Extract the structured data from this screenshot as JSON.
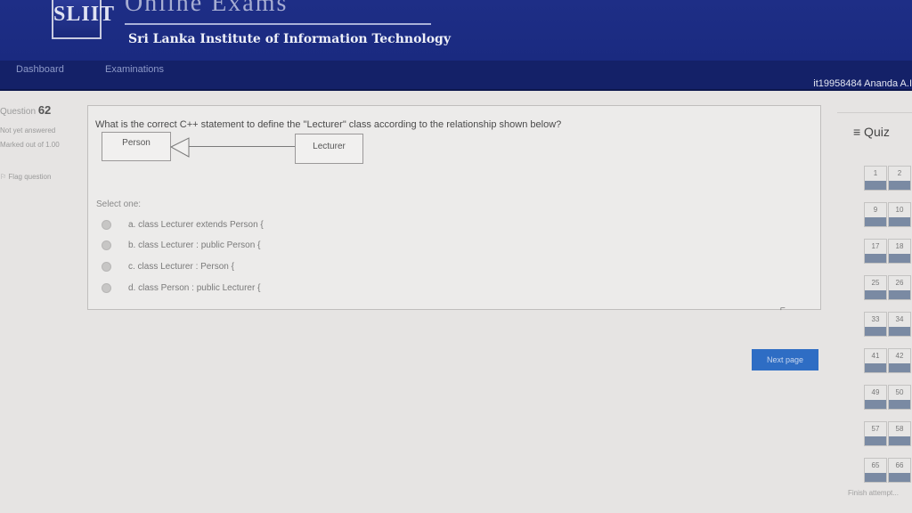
{
  "header": {
    "logo_text": "SLIIT",
    "exam_title": "Online Exams",
    "institute": "Sri Lanka Institute of Information Technology"
  },
  "nav": {
    "dashboard": "Dashboard",
    "examinations": "Examinations",
    "user": "it19958484 Ananda A.I"
  },
  "info": {
    "question_label": "Question",
    "question_number": "62",
    "state": "Not yet answered",
    "marks": "Marked out of 1.00",
    "flag": "Flag question"
  },
  "question": {
    "text": "What is the correct C++ statement to define the \"Lecturer\" class according to the relationship shown below?",
    "uml_person": "Person",
    "uml_lecturer": "Lecturer",
    "select_one": "Select one:",
    "options": [
      "a. class Lecturer extends Person {",
      "b. class Lecturer : public Person {",
      "c. class Lecturer : Person {",
      "d. class Person : public Lecturer {"
    ]
  },
  "next_button": "Next page",
  "quiz_nav": {
    "title": "≡ Quiz",
    "numbers": [
      "1",
      "2",
      "9",
      "10",
      "17",
      "18",
      "25",
      "26",
      "33",
      "34",
      "41",
      "42",
      "49",
      "50",
      "57",
      "58",
      "65",
      "66"
    ],
    "finish": "Finish attempt..."
  }
}
